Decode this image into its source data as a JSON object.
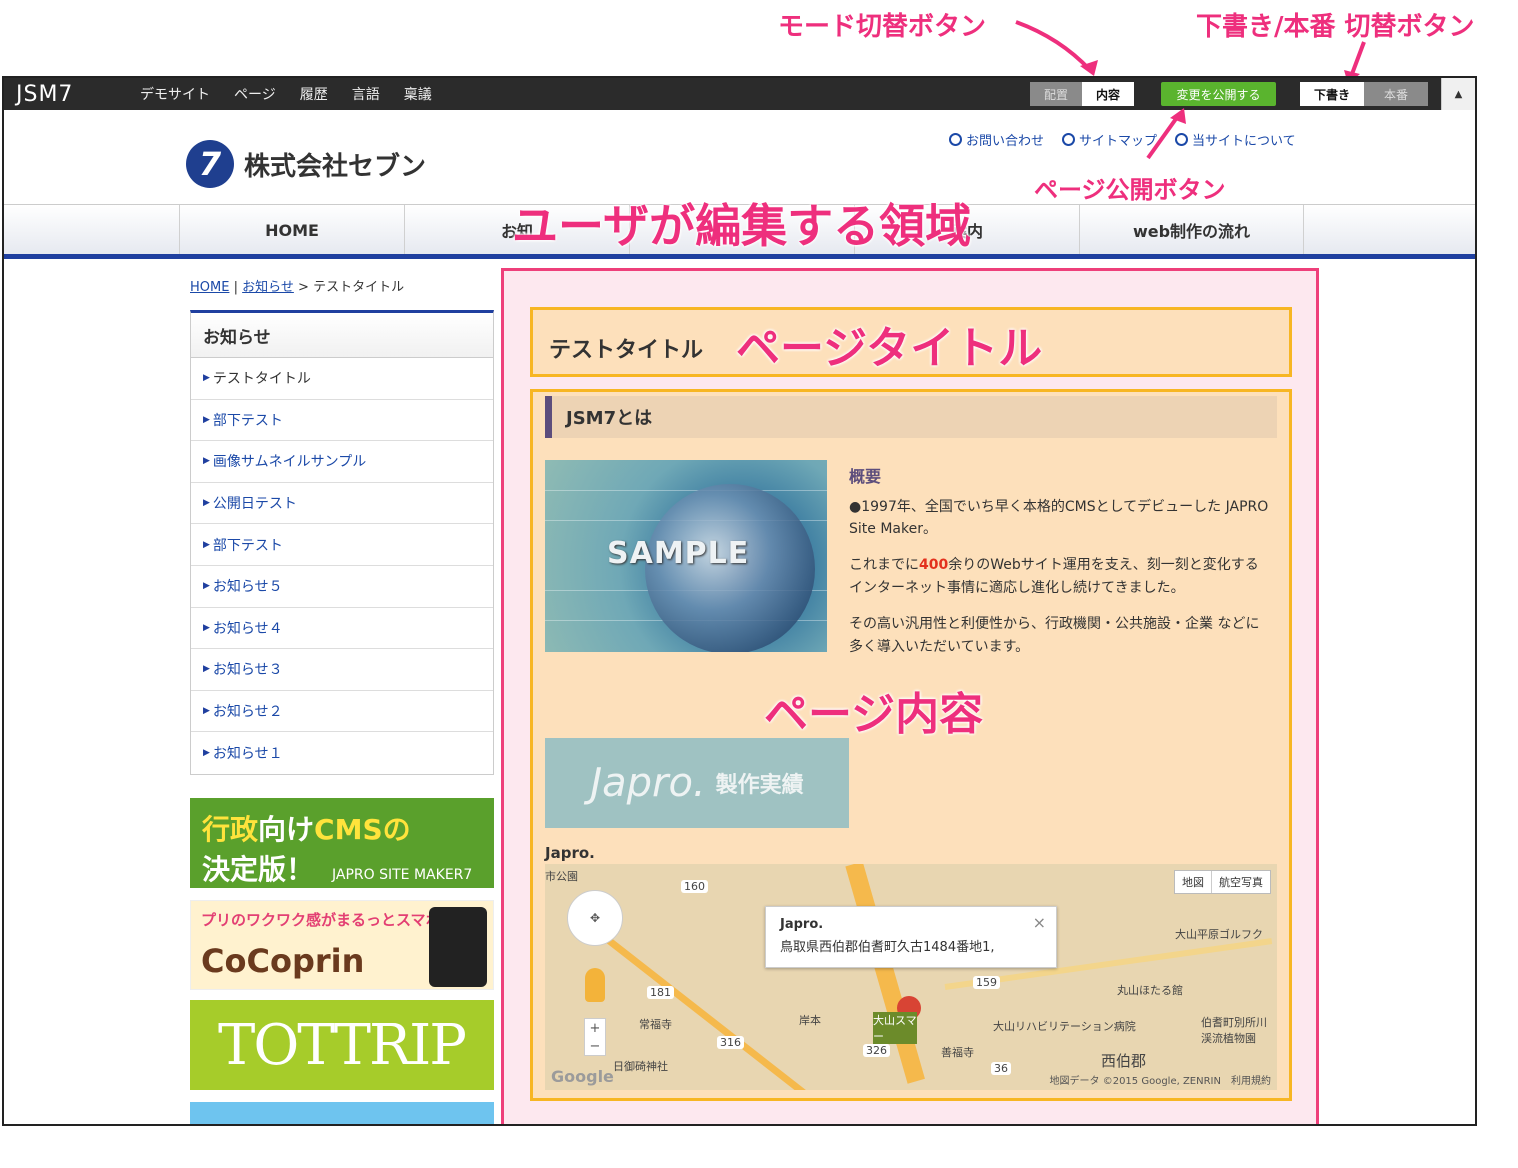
{
  "annotations": {
    "mode_toggle": "モード切替ボタン",
    "draft_toggle": "下書き/本番 切替ボタン",
    "publish": "ページ公開ボタン",
    "edit_region": "ユーザが編集する領域",
    "page_title": "ページタイトル",
    "page_content": "ページ内容"
  },
  "adminbar": {
    "logo": "JSM7",
    "menu": [
      "デモサイト",
      "ページ",
      "履歴",
      "言語",
      "稟議"
    ],
    "mode_layout": "配置",
    "mode_content": "内容",
    "publish": "変更を公開する",
    "draft": "下書き",
    "live": "本番",
    "collapse": "▲"
  },
  "header": {
    "logo_mark": "7",
    "company": "株式会社セブン",
    "links": [
      "お問い合わせ",
      "サイトマップ",
      "当サイトについて"
    ]
  },
  "gnav": [
    "HOME",
    "お知",
    "",
    "案内",
    "web制作の流れ"
  ],
  "breadcrumb": {
    "home": "HOME",
    "sep1": "|",
    "news": "お知らせ",
    "sep2": ">",
    "current": "テストタイトル"
  },
  "sidemenu": {
    "title": "お知らせ",
    "items": [
      "テストタイトル",
      "部下テスト",
      "画像サムネイルサンプル",
      "公開日テスト",
      "部下テスト",
      "お知らせ５",
      "お知らせ４",
      "お知らせ３",
      "お知らせ２",
      "お知らせ１"
    ]
  },
  "banners": {
    "b1_prefix": "行政",
    "b1_mid": "向け",
    "b1_cms": "CMSの",
    "b1_line2": "決定版！",
    "b1_sub": "JAPRO SITE MAKER7",
    "b2_line1": "プリのワクワク感がまるっとスマホに♥",
    "b2_line2": "CoCoprin",
    "b3_text": "TOTTRIP"
  },
  "content": {
    "title": "テストタイトル",
    "h2": "JSM7とは",
    "sample": "SAMPLE",
    "overview_title": "概要",
    "p1": "●1997年、全国でいち早く本格的CMSとしてデビューした JAPRO Site Maker。",
    "p2_a": "これまでに",
    "p2_num": "400",
    "p2_b": "余りのWebサイト運用を支え、刻一刻と変化するインターネット事情に適応し進化し続けてきました。",
    "p3": "その高い汎用性と利便性から、行政機関・公共施設・企業 などに多く導入いただいています。",
    "japro": "Japro.",
    "japro_sub": "製作実績",
    "map_label": "Japro."
  },
  "map": {
    "type_map": "地図",
    "type_sat": "航空写真",
    "info_name": "Japro.",
    "info_addr": "鳥取県西伯郡伯耆町久古1484番地1,",
    "close": "×",
    "google": "Google",
    "copyright": "地図データ ©2015 Google, ZENRIN　利用規約",
    "places": [
      "常福寺",
      "岸本",
      "日御碕神社",
      "善福寺",
      "大山リハビリテーション病院",
      "丸山ほたる館",
      "大山平原ゴルフク",
      "伯耆町別所川渓流植物園",
      "西伯郡",
      "市公園",
      "大山スマー"
    ],
    "routes": [
      "160",
      "181",
      "316",
      "326",
      "159",
      "36"
    ]
  }
}
